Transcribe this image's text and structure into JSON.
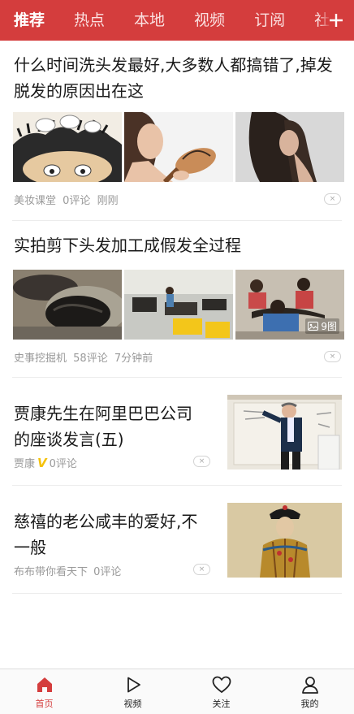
{
  "top_nav": {
    "tabs": [
      "推荐",
      "热点",
      "本地",
      "视频",
      "订阅",
      "社会"
    ],
    "active_index": 0,
    "accent_color": "#d43d3d"
  },
  "articles": [
    {
      "title": "什么时间洗头发最好,大多数人都搞错了,掉发脱发的原因出在这",
      "source": "美妆课堂",
      "comments": "0评论",
      "time": "刚刚",
      "layout": "three-images"
    },
    {
      "title": "实拍剪下头发加工成假发全过程",
      "source": "史事挖掘机",
      "comments": "58评论",
      "time": "7分钟前",
      "image_count": "9图",
      "layout": "three-images"
    },
    {
      "title": "贾康先生在阿里巴巴公司的座谈发言(五)",
      "source": "贾康",
      "verified_badge": "V",
      "comments": "0评论",
      "layout": "right-image"
    },
    {
      "title": "慈禧的老公咸丰的爱好,不一般",
      "source": "布布带你看天下",
      "comments": "0评论",
      "layout": "right-image"
    }
  ],
  "dislike_symbol": "×",
  "bottom_nav": {
    "items": [
      {
        "label": "首页",
        "icon": "home-icon"
      },
      {
        "label": "视频",
        "icon": "play-icon"
      },
      {
        "label": "关注",
        "icon": "heart-icon"
      },
      {
        "label": "我的",
        "icon": "user-icon"
      }
    ],
    "active_index": 0
  }
}
